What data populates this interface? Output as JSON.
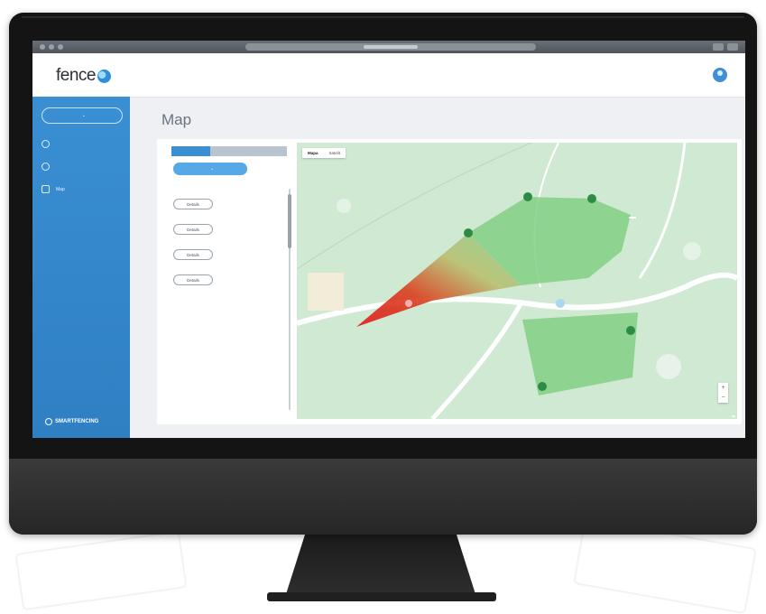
{
  "app": {
    "logo_text": "fence",
    "url_text": "",
    "brand_text": "SMARTFENCING"
  },
  "header": {
    "user_name": "",
    "user_role": ""
  },
  "sidebar": {
    "org_button": "",
    "items": [
      {
        "label": "",
        "icon": "clock-icon"
      },
      {
        "label": "",
        "icon": "globe-icon"
      },
      {
        "label": "Map",
        "icon": "map-pin-icon"
      }
    ]
  },
  "main": {
    "breadcrumb": "",
    "title": "Map",
    "tabs": [
      {
        "label": ""
      },
      {
        "label": ""
      },
      {
        "label": ""
      }
    ],
    "filter_button": "",
    "list": [
      {
        "title": "",
        "subtitle": "",
        "label": "",
        "value": "",
        "details": "Details",
        "deactivate": ""
      },
      {
        "title": "",
        "subtitle": "",
        "label": "",
        "value": "",
        "details": "Details",
        "deactivate": ""
      },
      {
        "title": "",
        "subtitle": "",
        "label": "",
        "value": "",
        "details": "Details",
        "deactivate": ""
      },
      {
        "title": "",
        "subtitle": "",
        "label": "",
        "value": "",
        "details": "Details",
        "deactivate": ""
      }
    ]
  },
  "map": {
    "type_buttons": [
      "Mapa",
      "Satelit"
    ],
    "zoom_in": "+",
    "zoom_out": "−",
    "place_label": "",
    "attribution": ""
  },
  "colors": {
    "accent": "#3a8fd3",
    "zone_fill": "#7fcf7f",
    "alert": "#e02020",
    "deactivate": "#e04a5f"
  }
}
